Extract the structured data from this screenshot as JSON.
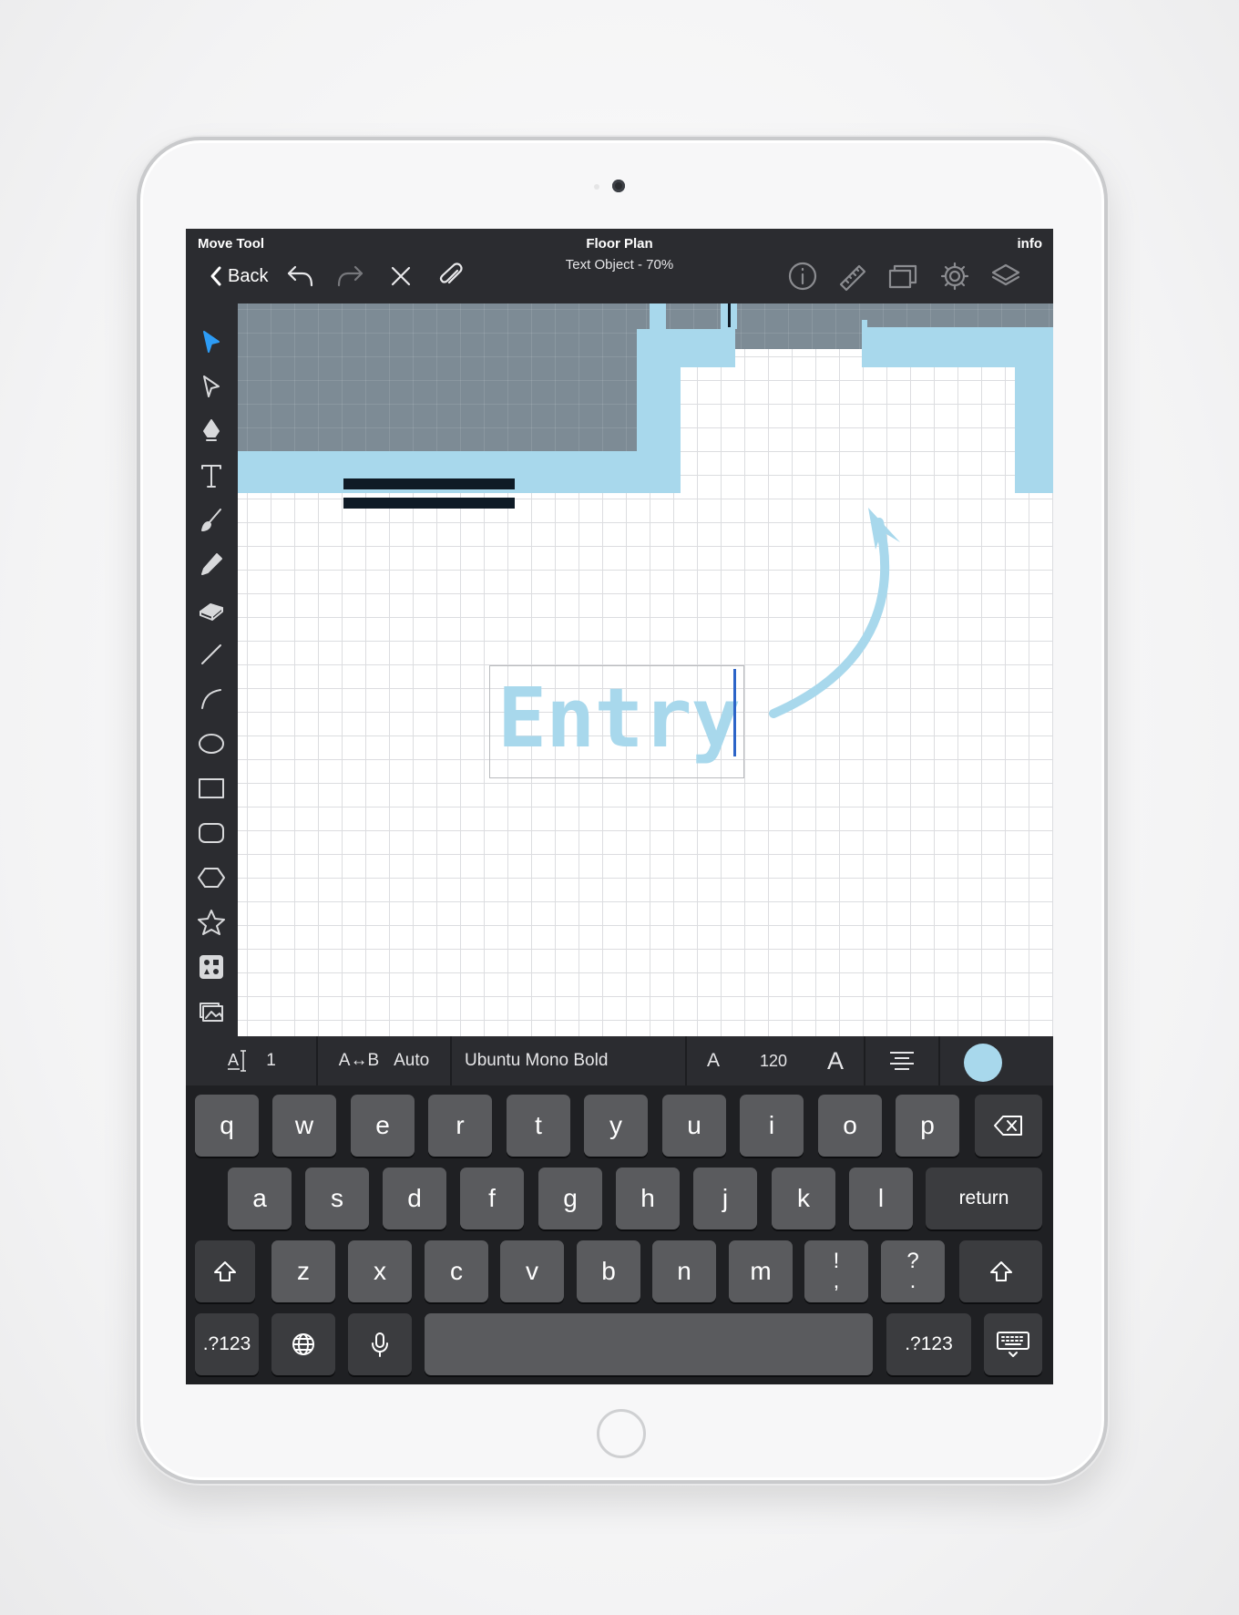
{
  "header": {
    "mode_label": "Move Tool",
    "title": "Floor Plan",
    "subtitle": "Text Object - 70%",
    "info_label": "info",
    "back_label": "Back"
  },
  "toolbar_icons": [
    "undo-icon",
    "redo-icon",
    "close-icon",
    "paperclip-icon",
    "info-icon",
    "ruler-icon",
    "pages-icon",
    "gear-icon",
    "layers-icon"
  ],
  "tools": [
    "select-arrow",
    "direct-select",
    "pen",
    "text",
    "brush",
    "pencil",
    "eraser",
    "line",
    "arc",
    "ellipse",
    "rectangle",
    "rounded-rectangle",
    "hexagon",
    "star",
    "shapes-library",
    "image"
  ],
  "canvas": {
    "text_object": "Entry",
    "accent_color": "#a8d8ec",
    "wall_color": "#a8d8ec",
    "room_color": "#7d8b95"
  },
  "formatbar": {
    "line_spacing_value": "1",
    "letter_spacing_label": "A↔B",
    "letter_spacing_value": "Auto",
    "font_name": "Ubuntu Mono Bold",
    "size_small_label": "A",
    "font_size": "120",
    "size_large_label": "A",
    "text_color": "#a8d8ec"
  },
  "keyboard": {
    "row1": [
      "q",
      "w",
      "e",
      "r",
      "t",
      "y",
      "u",
      "i",
      "o",
      "p"
    ],
    "row2": [
      "a",
      "s",
      "d",
      "f",
      "g",
      "h",
      "j",
      "k",
      "l"
    ],
    "row3": [
      "z",
      "x",
      "c",
      "v",
      "b",
      "n",
      "m"
    ],
    "punct1_top": "!",
    "punct1_bottom": ",",
    "punct2_top": "?",
    "punct2_bottom": ".",
    "return_label": "return",
    "numbers_label": ".?123"
  }
}
